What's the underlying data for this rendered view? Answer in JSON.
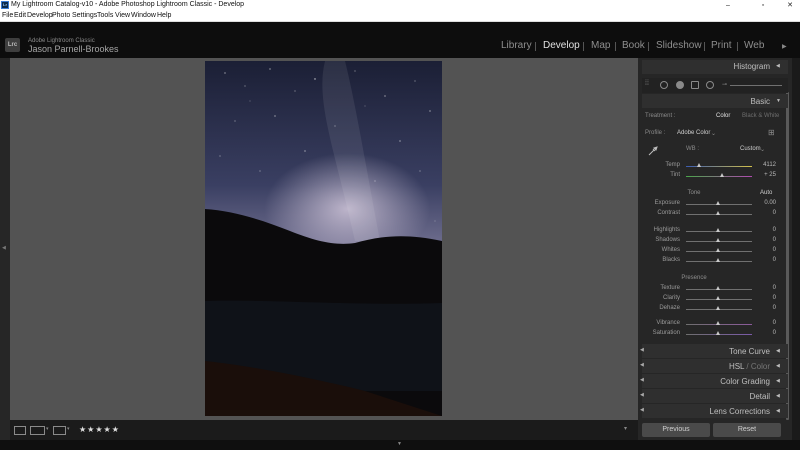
{
  "titlebar": {
    "title": "My Lightroom Catalog-v10 - Adobe Photoshop Lightroom Classic - Develop",
    "minimize": "–",
    "maximize": "▫",
    "close": "✕"
  },
  "menu": [
    "File",
    "Edit",
    "Develop",
    "Photo",
    "Settings",
    "Tools",
    "View",
    "Window",
    "Help"
  ],
  "identity": {
    "logo": "Lrc",
    "app_name": "Adobe Lightroom Classic",
    "user_name": "Jason Parnell-Brookes"
  },
  "modules": [
    "Library",
    "Develop",
    "Map",
    "Book",
    "Slideshow",
    "Print",
    "Web"
  ],
  "active_module": "Develop",
  "panel": {
    "histogram": "Histogram",
    "basic": "Basic",
    "treatment_label": "Treatment :",
    "treatment_color": "Color",
    "treatment_bw": "Black & White",
    "profile_label": "Profile :",
    "profile_value": "Adobe Color",
    "wb_label": "WB :",
    "wb_value": "Custom",
    "temp_label": "Temp",
    "temp_value": "4112",
    "tint_label": "Tint",
    "tint_value": "+ 25",
    "tone": "Tone",
    "auto": "Auto",
    "exposure_label": "Exposure",
    "exposure_value": "0.00",
    "contrast_label": "Contrast",
    "contrast_value": "0",
    "highlights_label": "Highlights",
    "highlights_value": "0",
    "shadows_label": "Shadows",
    "shadows_value": "0",
    "whites_label": "Whites",
    "whites_value": "0",
    "blacks_label": "Blacks",
    "blacks_value": "0",
    "presence": "Presence",
    "texture_label": "Texture",
    "texture_value": "0",
    "clarity_label": "Clarity",
    "clarity_value": "0",
    "dehaze_label": "Dehaze",
    "dehaze_value": "0",
    "vibrance_label": "Vibrance",
    "vibrance_value": "0",
    "saturation_label": "Saturation",
    "saturation_value": "0",
    "tone_curve": "Tone Curve",
    "hsl": "HSL",
    "hsl_sep": " / ",
    "hsl_color": "Color",
    "color_grading": "Color Grading",
    "detail": "Detail",
    "lens_corrections": "Lens Corrections",
    "previous": "Previous",
    "reset": "Reset"
  },
  "toolbar": {
    "stars": "★★★★★"
  },
  "colors": {
    "background": "#535353",
    "panel": "#262626",
    "accent": "#e0e0e0"
  }
}
